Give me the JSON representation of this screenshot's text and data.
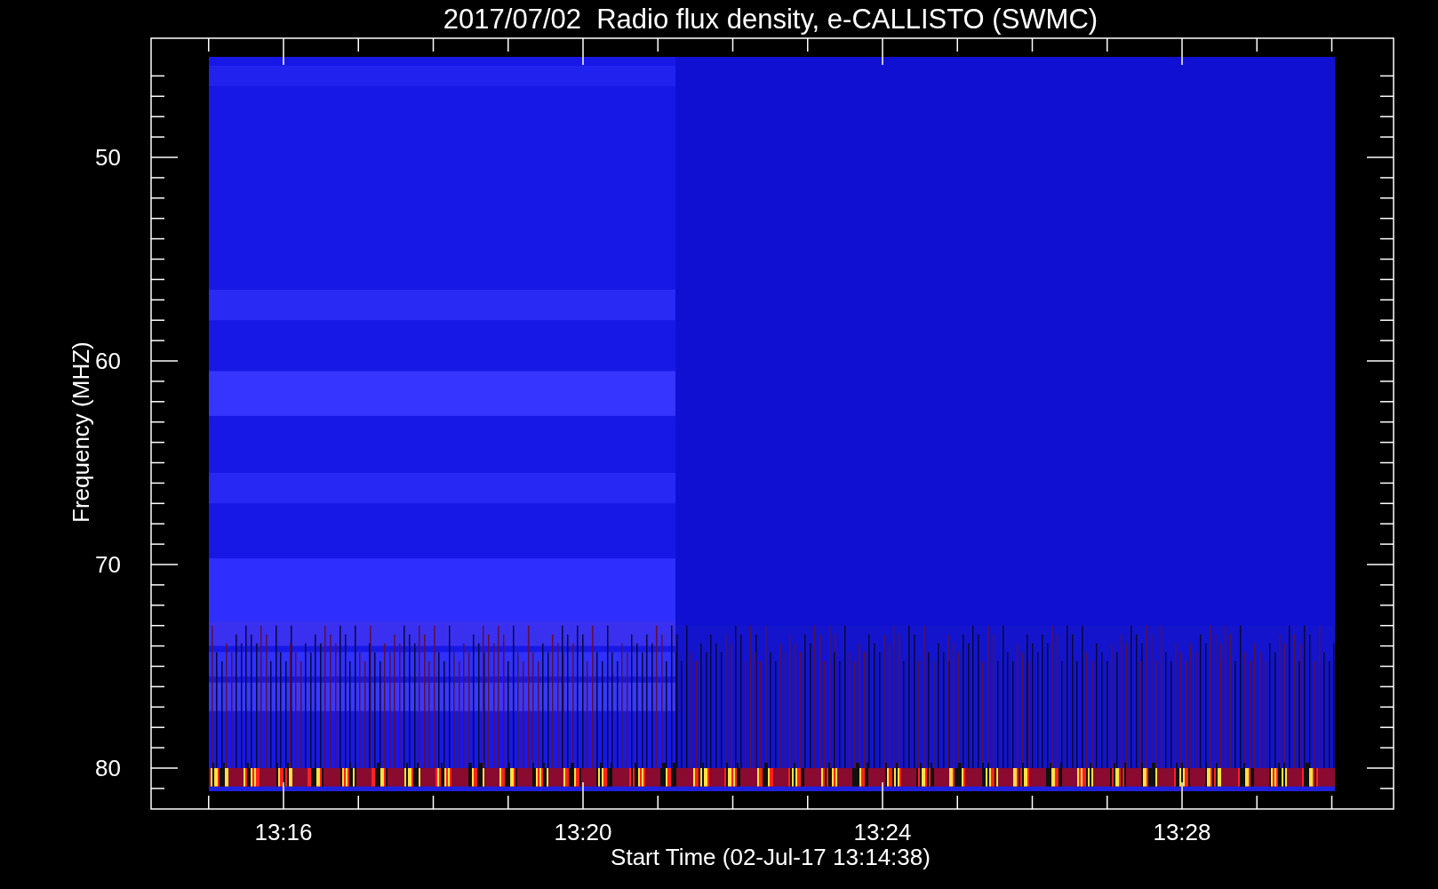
{
  "title": "2017/07/02  Radio flux density, e-CALLISTO (SWMC)",
  "plot": {
    "ylabel": "Frequency (MHZ)",
    "xlabel": "Start Time (02-Jul-17 13:14:38)",
    "yticks": [
      "50",
      "60",
      "70",
      "80"
    ],
    "xticks": [
      "13:16",
      "13:20",
      "13:24",
      "13:28"
    ]
  }
}
